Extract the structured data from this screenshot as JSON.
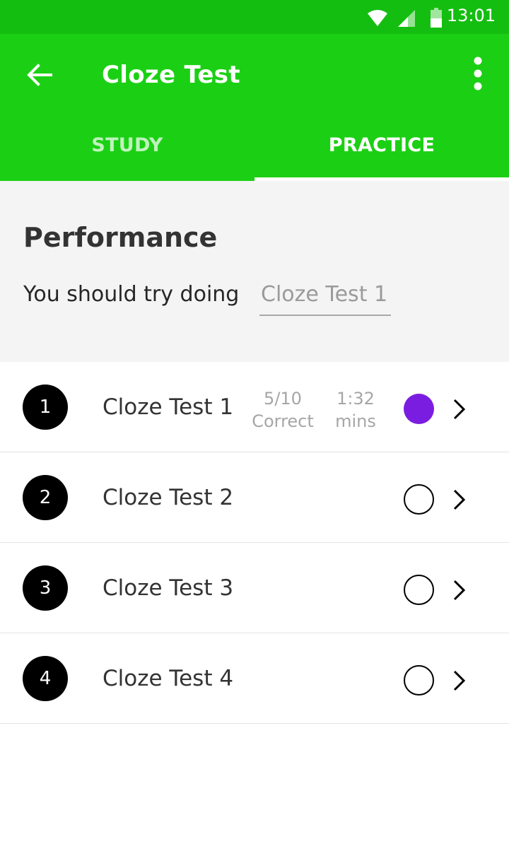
{
  "status_bar": {
    "time": "13:01",
    "icons": [
      "wifi-icon",
      "cellular-signal-icon",
      "battery-icon"
    ]
  },
  "app_bar": {
    "title": "Cloze Test",
    "back_icon": "arrow-left-icon",
    "menu_icon": "more-vert-icon"
  },
  "tabs": [
    {
      "label": "STUDY",
      "selected": false
    },
    {
      "label": "PRACTICE",
      "selected": true
    }
  ],
  "performance": {
    "heading": "Performance",
    "prompt": "You should try doing",
    "suggestion": "Cloze Test 1"
  },
  "tests": [
    {
      "number": "1",
      "title": "Cloze Test 1",
      "score": "5/10",
      "score_label": "Correct",
      "time": "1:32",
      "time_label": "mins",
      "completed": true
    },
    {
      "number": "2",
      "title": "Cloze Test 2",
      "completed": false
    },
    {
      "number": "3",
      "title": "Cloze Test 3",
      "completed": false
    },
    {
      "number": "4",
      "title": "Cloze Test 4",
      "completed": false
    }
  ],
  "colors": {
    "status_bar": "#14be10",
    "app_bar": "#1bd014",
    "completed_dot": "#7b1de0"
  }
}
